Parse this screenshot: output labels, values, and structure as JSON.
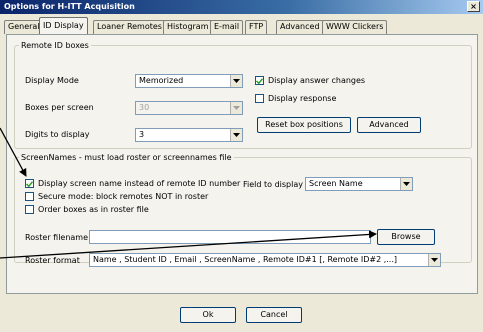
{
  "window": {
    "title": "Options for H-ITT Acquisition",
    "close_glyph": "×"
  },
  "tabs": [
    "General",
    "ID Display",
    "Loaner Remotes",
    "Histogram",
    "E-mail",
    "FTP",
    "Advanced",
    "WWW Clickers"
  ],
  "active_tab": "ID Display",
  "remote_id": {
    "legend": "Remote ID boxes",
    "display_mode_label": "Display Mode",
    "display_mode_value": "Memorized",
    "boxes_label": "Boxes per screen",
    "boxes_value": "30",
    "digits_label": "Digits to display",
    "digits_value": "3",
    "display_answer_changes": {
      "label": "Display answer changes",
      "checked": true
    },
    "display_response": {
      "label": "Display response",
      "checked": false
    },
    "reset_button": "Reset box positions",
    "advanced_button": "Advanced"
  },
  "screennames": {
    "legend": "ScreenNames - must load roster or screennames file",
    "display_screen_name": {
      "label": "Display screen name instead of remote ID number",
      "checked": true
    },
    "secure_mode": {
      "label": "Secure mode: block remotes NOT in roster",
      "checked": false
    },
    "order_boxes": {
      "label": "Order boxes as in roster file",
      "checked": false
    },
    "field_label": "Field to display",
    "field_value": "Screen Name",
    "roster_filename_label": "Roster filename",
    "roster_filename_value": "",
    "browse_button": "Browse",
    "roster_format_label": "Roster format",
    "roster_format_value": "Name , Student ID , Email , ScreenName , Remote ID#1 [, Remote ID#2 ,...]"
  },
  "footer": {
    "ok_button": "Ok",
    "cancel_button": "Cancel"
  },
  "colors": {
    "title_start": "#0a246a",
    "title_end": "#a6caf0",
    "face": "#ece9d8",
    "field_border": "#7f9db9"
  }
}
